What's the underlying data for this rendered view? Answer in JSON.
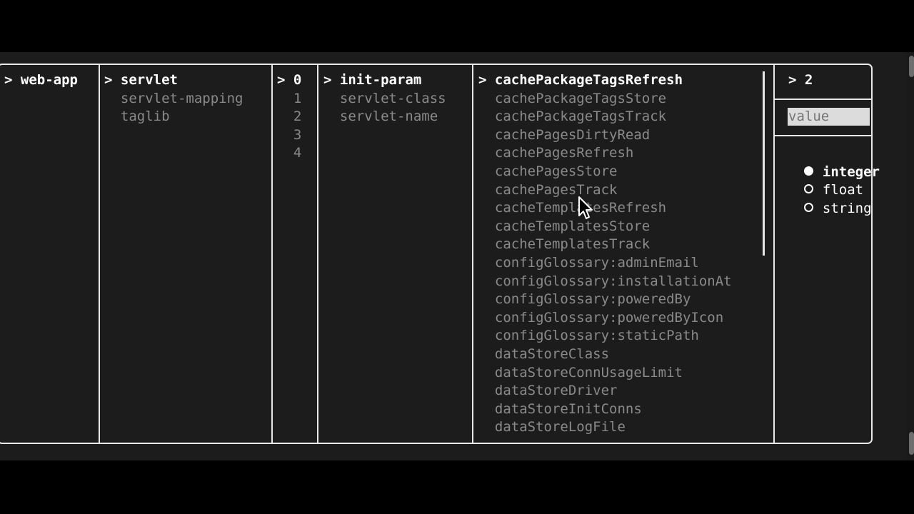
{
  "columns": [
    {
      "prompt": ">",
      "items": [
        "web-app"
      ],
      "selected_index": 0
    },
    {
      "prompt": ">",
      "items": [
        "servlet",
        "servlet-mapping",
        "taglib"
      ],
      "selected_index": 0
    },
    {
      "prompt": ">",
      "items": [
        "0",
        "1",
        "2",
        "3",
        "4"
      ],
      "selected_index": 0
    },
    {
      "prompt": ">",
      "items": [
        "init-param",
        "servlet-class",
        "servlet-name"
      ],
      "selected_index": 0
    },
    {
      "prompt": ">",
      "items": [
        "cachePackageTagsRefresh",
        "cachePackageTagsStore",
        "cachePackageTagsTrack",
        "cachePagesDirtyRead",
        "cachePagesRefresh",
        "cachePagesStore",
        "cachePagesTrack",
        "cacheTemplatesRefresh",
        "cacheTemplatesStore",
        "cacheTemplatesTrack",
        "configGlossary:adminEmail",
        "configGlossary:installationAt",
        "configGlossary:poweredBy",
        "configGlossary:poweredByIcon",
        "configGlossary:staticPath",
        "dataStoreClass",
        "dataStoreConnUsageLimit",
        "dataStoreDriver",
        "dataStoreInitConns",
        "dataStoreLogFile"
      ],
      "selected_index": 0
    }
  ],
  "editor": {
    "prompt": ">",
    "value_display": "2",
    "input_placeholder": "value",
    "types": [
      {
        "label": "integer",
        "selected": true
      },
      {
        "label": "float",
        "selected": false
      },
      {
        "label": "string",
        "selected": false
      }
    ]
  },
  "colors": {
    "background": "#1c1c1c",
    "border": "#e8e8e8",
    "selected_text": "#ffffff",
    "dim_text": "#8a8a8a"
  }
}
